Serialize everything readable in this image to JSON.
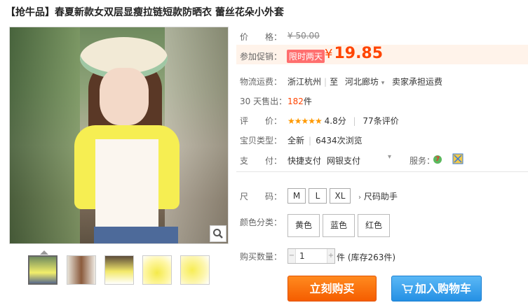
{
  "title": "【抢牛品】春夏新款女双层显瘦拉链短款防晒衣 蕾丝花朵小外套",
  "gallery": {
    "zoom_icon": "magnifier-icon",
    "thumbnails": [
      "thumb-1",
      "thumb-2",
      "thumb-3",
      "thumb-4",
      "thumb-5"
    ]
  },
  "price": {
    "label": "价　　格：",
    "original": "¥ 50.00"
  },
  "promo": {
    "label": "参加促销：",
    "tag": "限时两天",
    "symbol": "¥",
    "price": "19.85"
  },
  "shipping": {
    "label": "物流运费：",
    "from": "浙江杭州",
    "to_prefix": "至",
    "to": "河北廊坊",
    "note": "卖家承担运费"
  },
  "sales": {
    "label": "30 天售出：",
    "count": "182",
    "unit": "件"
  },
  "rating": {
    "label": "评　　价：",
    "stars": "★★★★★",
    "score": "4.8分",
    "reviews": "77条评价"
  },
  "item_type": {
    "label": "宝贝类型：",
    "condition": "全新",
    "views": "6434次浏览"
  },
  "payment": {
    "label": "支　　付：",
    "methods": [
      "快捷支付",
      "网银支付"
    ],
    "service_label": "服务："
  },
  "size": {
    "label": "尺　　码：",
    "options": [
      "M",
      "L",
      "XL"
    ],
    "helper": "尺码助手"
  },
  "color": {
    "label": "颜色分类：",
    "options": [
      "黄色",
      "蓝色",
      "红色"
    ]
  },
  "quantity": {
    "label": "购买数量：",
    "value": "1",
    "stock_note": "件 (库存263件)"
  },
  "buttons": {
    "buy_now": "立刻购买",
    "add_cart": "加入购物车"
  }
}
